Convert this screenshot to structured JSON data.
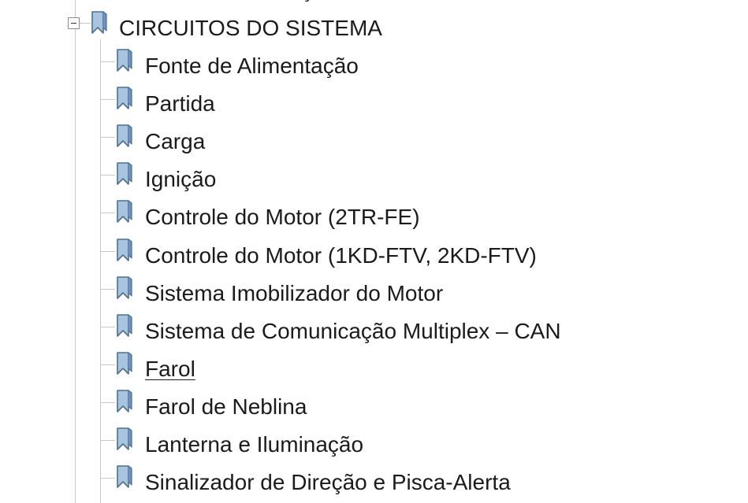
{
  "parent": {
    "label": "CIRCUITOS DO SISTEMA",
    "expanded": true,
    "icon": "bookmark-icon"
  },
  "children": [
    {
      "label": "Fonte de Alimentação",
      "icon": "bookmark-icon",
      "underlined": false
    },
    {
      "label": "Partida",
      "icon": "bookmark-icon",
      "underlined": false
    },
    {
      "label": "Carga",
      "icon": "bookmark-icon",
      "underlined": false
    },
    {
      "label": "Ignição",
      "icon": "bookmark-icon",
      "underlined": false
    },
    {
      "label": "Controle do Motor (2TR-FE)",
      "icon": "bookmark-icon",
      "underlined": false
    },
    {
      "label": "Controle do Motor (1KD-FTV, 2KD-FTV)",
      "icon": "bookmark-icon",
      "underlined": false
    },
    {
      "label": "Sistema Imobilizador do Motor",
      "icon": "bookmark-icon",
      "underlined": false
    },
    {
      "label": "Sistema de Comunicação Multiplex – CAN",
      "icon": "bookmark-icon",
      "underlined": false
    },
    {
      "label": "Farol",
      "icon": "bookmark-icon",
      "underlined": true
    },
    {
      "label": "Farol de Neblina",
      "icon": "bookmark-icon",
      "underlined": false
    },
    {
      "label": "Lanterna e Iluminação",
      "icon": "bookmark-icon",
      "underlined": false
    },
    {
      "label": "Sinalizador de Direção e Pisca-Alerta",
      "icon": "bookmark-icon",
      "underlined": false
    }
  ],
  "colors": {
    "text": "#1b1b1b",
    "tree_line": "#c8c8c8",
    "icon_fill": "#a9c4de",
    "icon_stroke": "#4d6f93"
  }
}
